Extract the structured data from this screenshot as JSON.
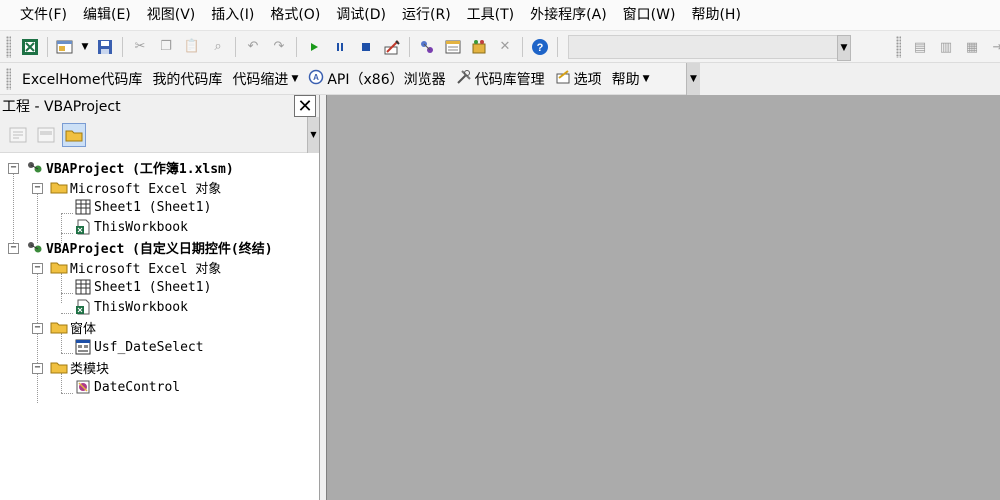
{
  "menubar": {
    "items": [
      "文件(F)",
      "编辑(E)",
      "视图(V)",
      "插入(I)",
      "格式(O)",
      "调试(D)",
      "运行(R)",
      "工具(T)",
      "外接程序(A)",
      "窗口(W)",
      "帮助(H)"
    ]
  },
  "toolbar2": {
    "excelhome": "ExcelHome代码库",
    "my_library": "我的代码库",
    "indent": "代码缩进",
    "api": "API（x86）浏览器",
    "manage": "代码库管理",
    "options": "选项",
    "help": "帮助"
  },
  "project_panel": {
    "title": "工程 - VBAProject",
    "close": "✕"
  },
  "tree": {
    "project1": "VBAProject (工作簿1.xlsm)",
    "p1_objects": "Microsoft Excel 对象",
    "p1_sheet1": "Sheet1 (Sheet1)",
    "p1_thisworkbook": "ThisWorkbook",
    "project2": "VBAProject (自定义日期控件(终结)",
    "p2_objects": "Microsoft Excel 对象",
    "p2_sheet1": "Sheet1 (Sheet1)",
    "p2_thisworkbook": "ThisWorkbook",
    "p2_forms": "窗体",
    "p2_form1": "Usf_DateSelect",
    "p2_classes": "类模块",
    "p2_class1": "DateControl"
  },
  "colors": {
    "workspace": "#ababab",
    "panel_bg": "#ffffff",
    "run_green": "#1a9a1a",
    "help_blue": "#1e64c8"
  }
}
